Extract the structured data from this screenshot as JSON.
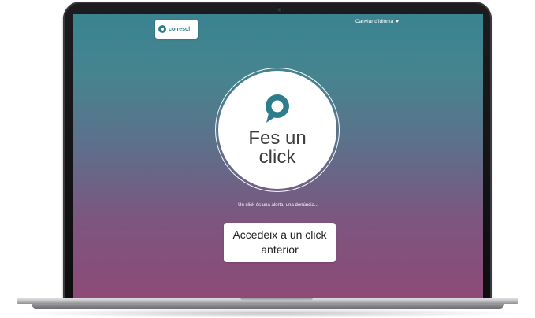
{
  "header": {
    "logo_text": "co-resol",
    "language_menu_label": "Canviar d'idioma"
  },
  "main": {
    "cta_line1": "Fes un",
    "cta_line2": "click",
    "tagline": "Un click és una alerta, una denúncia...",
    "access_line1": "Accedeix a un click",
    "access_line2": "anterior"
  },
  "icons": {
    "logo": "co-resol-logo-icon",
    "language_caret": "caret-down-icon",
    "speech_bubble": "speech-bubble-icon"
  },
  "colors": {
    "brand_teal": "#2f7d8c",
    "gradient_top": "#3a8391",
    "gradient_bottom": "#8d4a78",
    "text_dark": "#3d3d3d"
  }
}
